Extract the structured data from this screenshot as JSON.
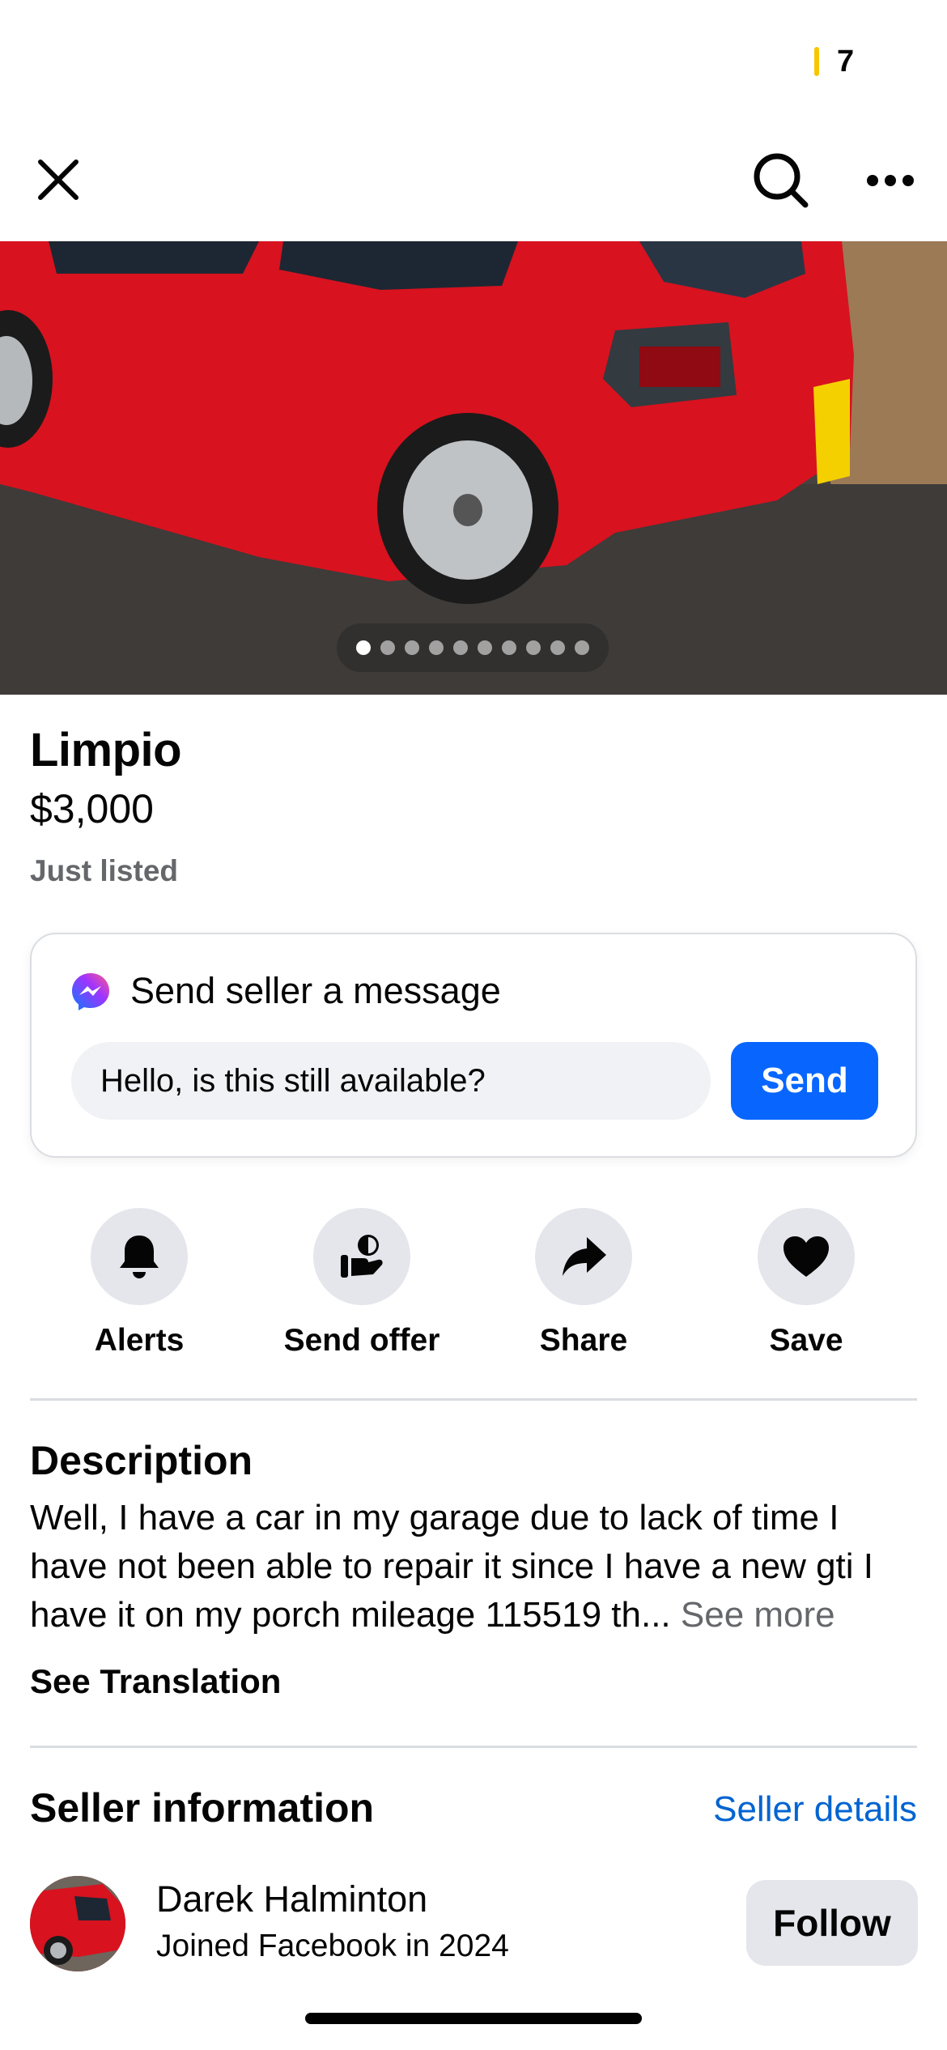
{
  "status_bar": {
    "count": "7"
  },
  "nav": {
    "close_icon": "close-icon",
    "search_icon": "search-icon",
    "more_icon": "more-icon"
  },
  "photo": {
    "total_images": 10,
    "current_index": 1
  },
  "listing": {
    "title": "Limpio",
    "price": "$3,000",
    "listed": "Just listed"
  },
  "message": {
    "heading": "Send seller a message",
    "input_value": "Hello, is this still available?",
    "send_label": "Send",
    "icon": "messenger-icon"
  },
  "actions": [
    {
      "label": "Alerts",
      "icon": "bell-icon"
    },
    {
      "label": "Send offer",
      "icon": "offer-icon"
    },
    {
      "label": "Share",
      "icon": "share-icon"
    },
    {
      "label": "Save",
      "icon": "heart-icon"
    }
  ],
  "description": {
    "heading": "Description",
    "line1": "Well, I have a car in my garage due to lack of time I",
    "line2": "have not been able to repair it since I have a new gti I",
    "line3": "have it on my porch mileage 115519 th...",
    "see_more": "See more",
    "see_translation": "See Translation"
  },
  "seller": {
    "heading": "Seller information",
    "details_link": "Seller details",
    "name": "Darek Halminton",
    "joined": "Joined Facebook in 2024",
    "follow_label": "Follow"
  },
  "colors": {
    "accent": "#0866ff",
    "link": "#0064d1",
    "secondary_text": "#65676b",
    "chip_bg": "#e4e6eb"
  }
}
